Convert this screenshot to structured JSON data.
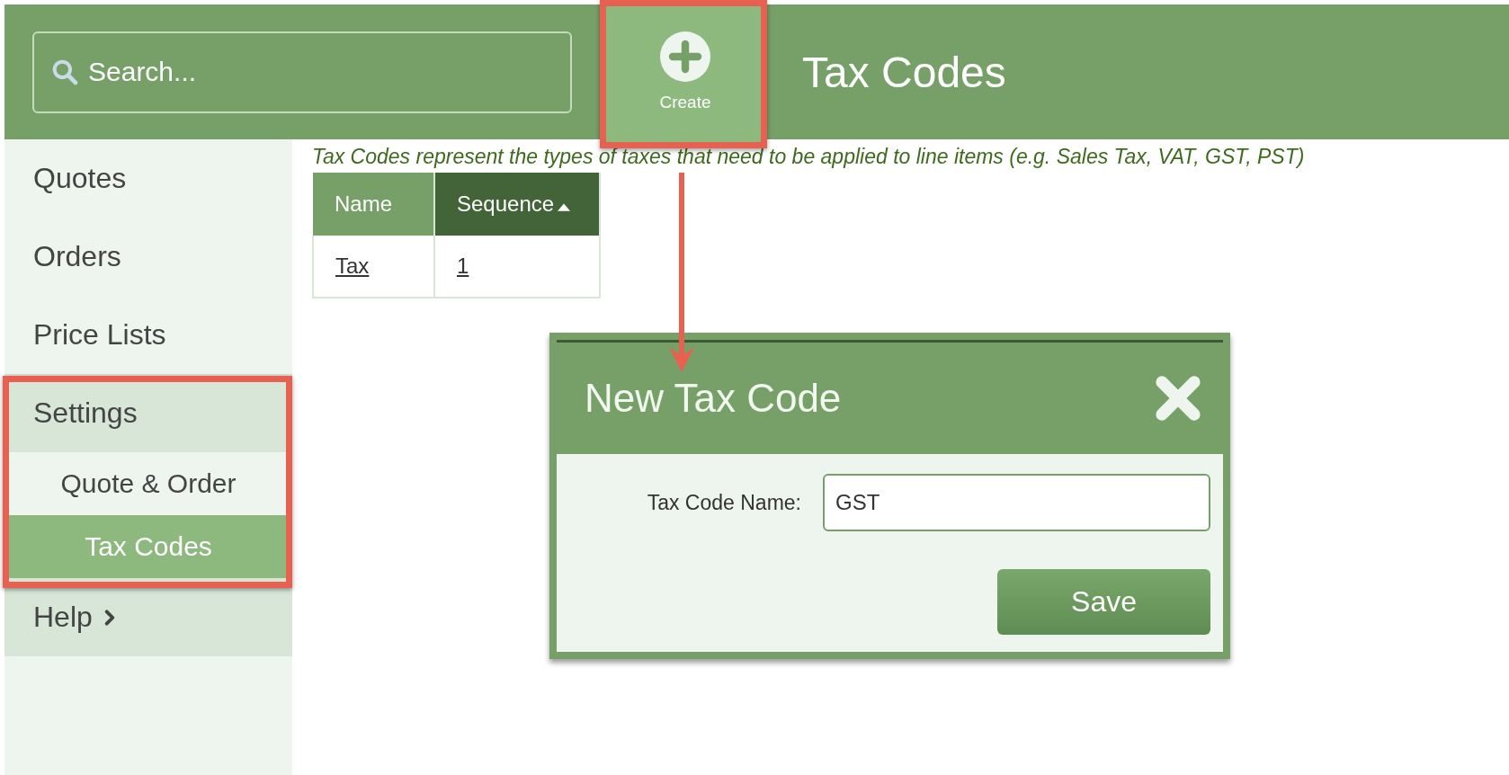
{
  "search": {
    "placeholder": "Search..."
  },
  "create_button": {
    "label": "Create"
  },
  "page_title": "Tax Codes",
  "sidebar": {
    "items": [
      {
        "label": "Quotes",
        "kind": "link",
        "selected": false
      },
      {
        "label": "Orders",
        "kind": "link",
        "selected": false
      },
      {
        "label": "Price Lists",
        "kind": "link",
        "selected": false
      },
      {
        "label": "Settings",
        "kind": "group",
        "expanded": true,
        "children": [
          {
            "label": "Quote & Order",
            "selected": false
          },
          {
            "label": "Tax Codes",
            "selected": true
          }
        ]
      },
      {
        "label": "Help",
        "kind": "group",
        "expanded": false
      }
    ]
  },
  "description": "Tax Codes represent the types of taxes that need to be applied to line items (e.g. Sales Tax, VAT, GST, PST)",
  "table": {
    "columns": [
      {
        "label": "Name",
        "sorted": false
      },
      {
        "label": "Sequence",
        "sorted": true
      }
    ],
    "rows": [
      [
        "Tax",
        "1"
      ]
    ]
  },
  "dialog": {
    "title": "New Tax Code",
    "field_label": "Tax Code Name:",
    "field_value": "GST",
    "button": "Save"
  }
}
